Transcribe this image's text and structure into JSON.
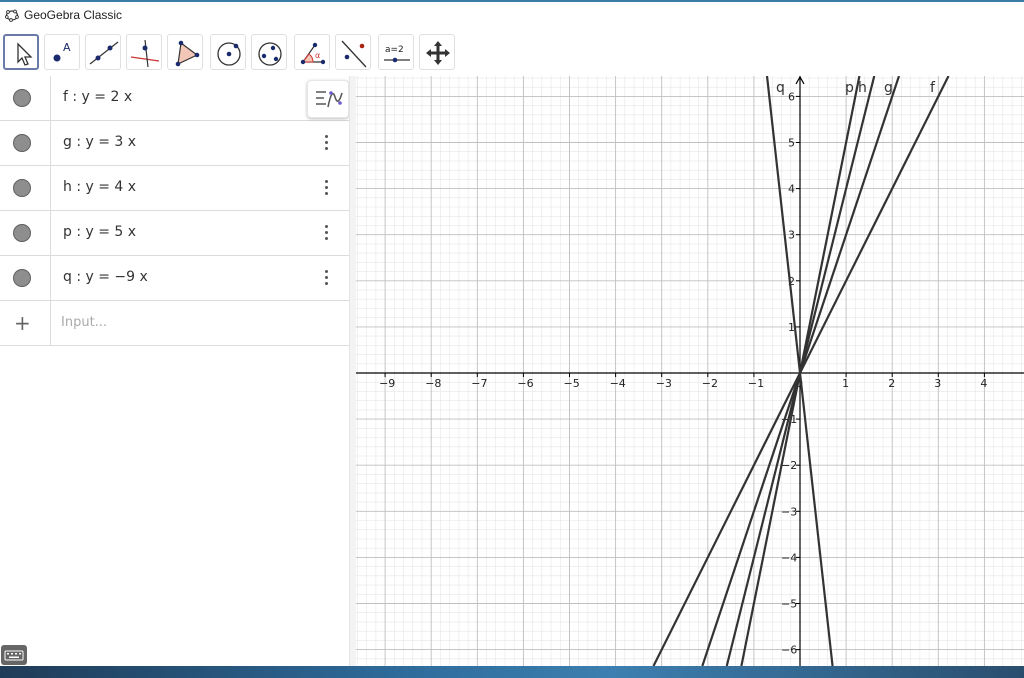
{
  "window": {
    "title": "GeoGebra Classic"
  },
  "toolbar": {
    "tools": [
      {
        "name": "move-tool-icon"
      },
      {
        "name": "point-tool-icon",
        "label": "A"
      },
      {
        "name": "line-tool-icon"
      },
      {
        "name": "perpendicular-line-tool-icon"
      },
      {
        "name": "polygon-tool-icon"
      },
      {
        "name": "circle-tool-icon"
      },
      {
        "name": "conic-tool-icon"
      },
      {
        "name": "angle-tool-icon",
        "label": "α"
      },
      {
        "name": "reflect-tool-icon"
      },
      {
        "name": "slider-tool-icon",
        "label": "a=2"
      },
      {
        "name": "move-view-tool-icon"
      }
    ]
  },
  "algebra": {
    "rows": [
      {
        "expr": "f : y = 2 x"
      },
      {
        "expr": "g : y = 3 x"
      },
      {
        "expr": "h : y = 4 x"
      },
      {
        "expr": "p : y = 5 x"
      },
      {
        "expr": "q : y = −9 x"
      }
    ],
    "input_placeholder": "Input..."
  },
  "chart_data": {
    "type": "line",
    "xlim": [
      -9,
      4
    ],
    "ylim": [
      -6,
      6
    ],
    "x_ticks": [
      "−9",
      "−8",
      "−7",
      "−6",
      "−5",
      "−4",
      "−3",
      "−2",
      "−1",
      "0",
      "1",
      "2",
      "3",
      "4"
    ],
    "y_ticks": [
      "6",
      "5",
      "4",
      "3",
      "2",
      "1",
      "−1",
      "−2",
      "−3",
      "−4",
      "−5",
      "−6"
    ],
    "series": [
      {
        "name": "f",
        "slope": 2
      },
      {
        "name": "g",
        "slope": 3
      },
      {
        "name": "h",
        "slope": 4
      },
      {
        "name": "p",
        "slope": 5
      },
      {
        "name": "q",
        "slope": -9
      }
    ],
    "grid": true
  },
  "colors": {
    "line": "#333333",
    "marble": "#8e8e8e",
    "axis": "#000000",
    "grid_major": "#c0c0c0",
    "grid_minor": "#e6e6e6"
  }
}
